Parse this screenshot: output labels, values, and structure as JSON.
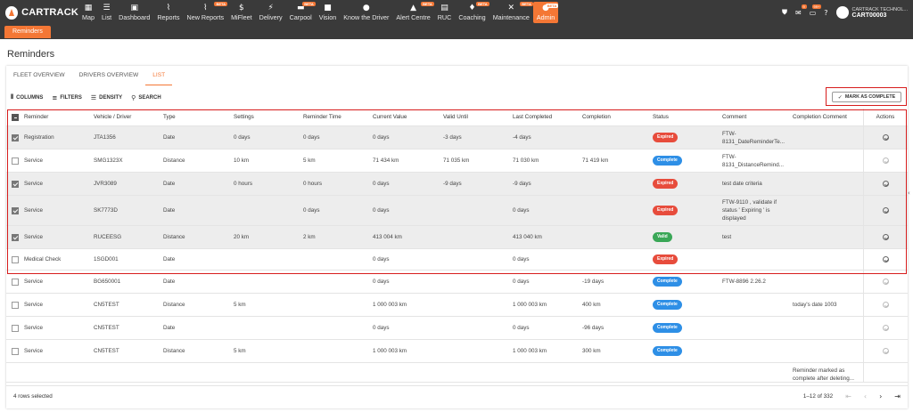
{
  "brand": "CARTRACK",
  "nav": [
    {
      "label": "Map",
      "icon": "map-icon",
      "glyph": "▦"
    },
    {
      "label": "List",
      "icon": "list-icon",
      "glyph": "☰"
    },
    {
      "label": "Dashboard",
      "icon": "dashboard-icon",
      "glyph": "▣"
    },
    {
      "label": "Reports",
      "icon": "reports-icon",
      "glyph": "⌇"
    },
    {
      "label": "New Reports",
      "icon": "new-reports-icon",
      "glyph": "⌇",
      "beta": "BETA"
    },
    {
      "label": "MiFleet",
      "icon": "dollar-icon",
      "glyph": "$"
    },
    {
      "label": "Delivery",
      "icon": "delivery-icon",
      "glyph": "⚡"
    },
    {
      "label": "Carpool",
      "icon": "carpool-icon",
      "glyph": "▬",
      "beta": "BETA"
    },
    {
      "label": "Vision",
      "icon": "vision-icon",
      "glyph": "■"
    },
    {
      "label": "Know the Driver",
      "icon": "driver-icon",
      "glyph": "●"
    },
    {
      "label": "Alert Centre",
      "icon": "alert-icon",
      "glyph": "▲",
      "beta": "BETA"
    },
    {
      "label": "RUC",
      "icon": "ruc-icon",
      "glyph": "▤"
    },
    {
      "label": "Coaching",
      "icon": "coaching-icon",
      "glyph": "♦",
      "beta": "BETA"
    },
    {
      "label": "Maintenance",
      "icon": "maintenance-icon",
      "glyph": "✕",
      "beta": "BETA"
    },
    {
      "label": "Admin",
      "icon": "admin-icon",
      "glyph": "●",
      "beta": "BETA",
      "active": true
    }
  ],
  "topright": {
    "badge1": "9",
    "badge2": "99+",
    "account_line1": "CARTRACK TECHNOL...",
    "account_line2": "CART00003"
  },
  "subtab": "Reminders",
  "page_title": "Reminders",
  "tabs": [
    "FLEET OVERVIEW",
    "DRIVERS OVERVIEW",
    "LIST"
  ],
  "toolbar": {
    "columns": "COLUMNS",
    "filters": "FILTERS",
    "density": "DENSITY",
    "search": "SEARCH",
    "mark_complete": "MARK AS COMPLETE"
  },
  "columns": [
    "Reminder",
    "Vehicle / Driver",
    "Type",
    "Settings",
    "Reminder Time",
    "Current Value",
    "Valid Until",
    "Last Completed",
    "Completion",
    "Status",
    "Comment",
    "Completion Comment",
    "Actions"
  ],
  "status_colors": {
    "Expired": "#e74c3c",
    "Complete": "#2e8fe6",
    "Valid": "#3aa757"
  },
  "rows": [
    {
      "checked": true,
      "cells": [
        "Registration",
        "JTA1356",
        "Date",
        "0 days",
        "0 days",
        "0 days",
        "-3 days",
        "-4 days",
        "",
        "Expired",
        "FTW-8131_DateReminderTe...",
        ""
      ]
    },
    {
      "checked": false,
      "cells": [
        "Service",
        "SMG1323X",
        "Distance",
        "10 km",
        "5 km",
        "71 434 km",
        "71 035 km",
        "71 030 km",
        "71 419 km",
        "Complete",
        "FTW-8131_DistanceRemind...",
        ""
      ]
    },
    {
      "checked": true,
      "cells": [
        "Service",
        "JVR3089",
        "Date",
        "0 hours",
        "0 hours",
        "0 days",
        "-9 days",
        "-9 days",
        "",
        "Expired",
        "test date criteria",
        ""
      ]
    },
    {
      "checked": true,
      "cells": [
        "Service",
        "SK7773D",
        "Date",
        "",
        "0 days",
        "0 days",
        "",
        "0 days",
        "",
        "Expired",
        "FTW-9110 , validate if status ' Expiring ' is displayed",
        ""
      ]
    },
    {
      "checked": true,
      "cells": [
        "Service",
        "RUCEESG",
        "Distance",
        "20 km",
        "2 km",
        "413 004 km",
        "",
        "413 040 km",
        "",
        "Valid",
        "test",
        ""
      ]
    },
    {
      "checked": false,
      "cells": [
        "Medical Check",
        "1SGD001",
        "Date",
        "",
        "",
        "0 days",
        "",
        "0 days",
        "",
        "Expired",
        "",
        ""
      ]
    },
    {
      "checked": false,
      "cells": [
        "Service",
        "BG650001",
        "Date",
        "",
        "",
        "0 days",
        "",
        "0 days",
        "-19 days",
        "Complete",
        "FTW-8896 2.26.2",
        ""
      ]
    },
    {
      "checked": false,
      "cells": [
        "Service",
        "CN5TEST",
        "Distance",
        "5 km",
        "",
        "1 000 003 km",
        "",
        "1 000 003 km",
        "400 km",
        "Complete",
        "",
        "today's date 1003"
      ]
    },
    {
      "checked": false,
      "cells": [
        "Service",
        "CN5TEST",
        "Date",
        "",
        "",
        "0 days",
        "",
        "0 days",
        "-96 days",
        "Complete",
        "",
        ""
      ]
    },
    {
      "checked": false,
      "cells": [
        "Service",
        "CN5TEST",
        "Distance",
        "5 km",
        "",
        "1 000 003 km",
        "",
        "1 000 003 km",
        "300 km",
        "Complete",
        "",
        ""
      ]
    },
    {
      "checked": false,
      "cells": [
        "",
        "",
        "",
        "",
        "",
        "",
        "",
        "",
        "",
        "",
        "",
        "Reminder marked as complete after deleting..."
      ]
    }
  ],
  "footer": {
    "rows_selected": "4 rows selected",
    "range": "1–12 of 332"
  }
}
